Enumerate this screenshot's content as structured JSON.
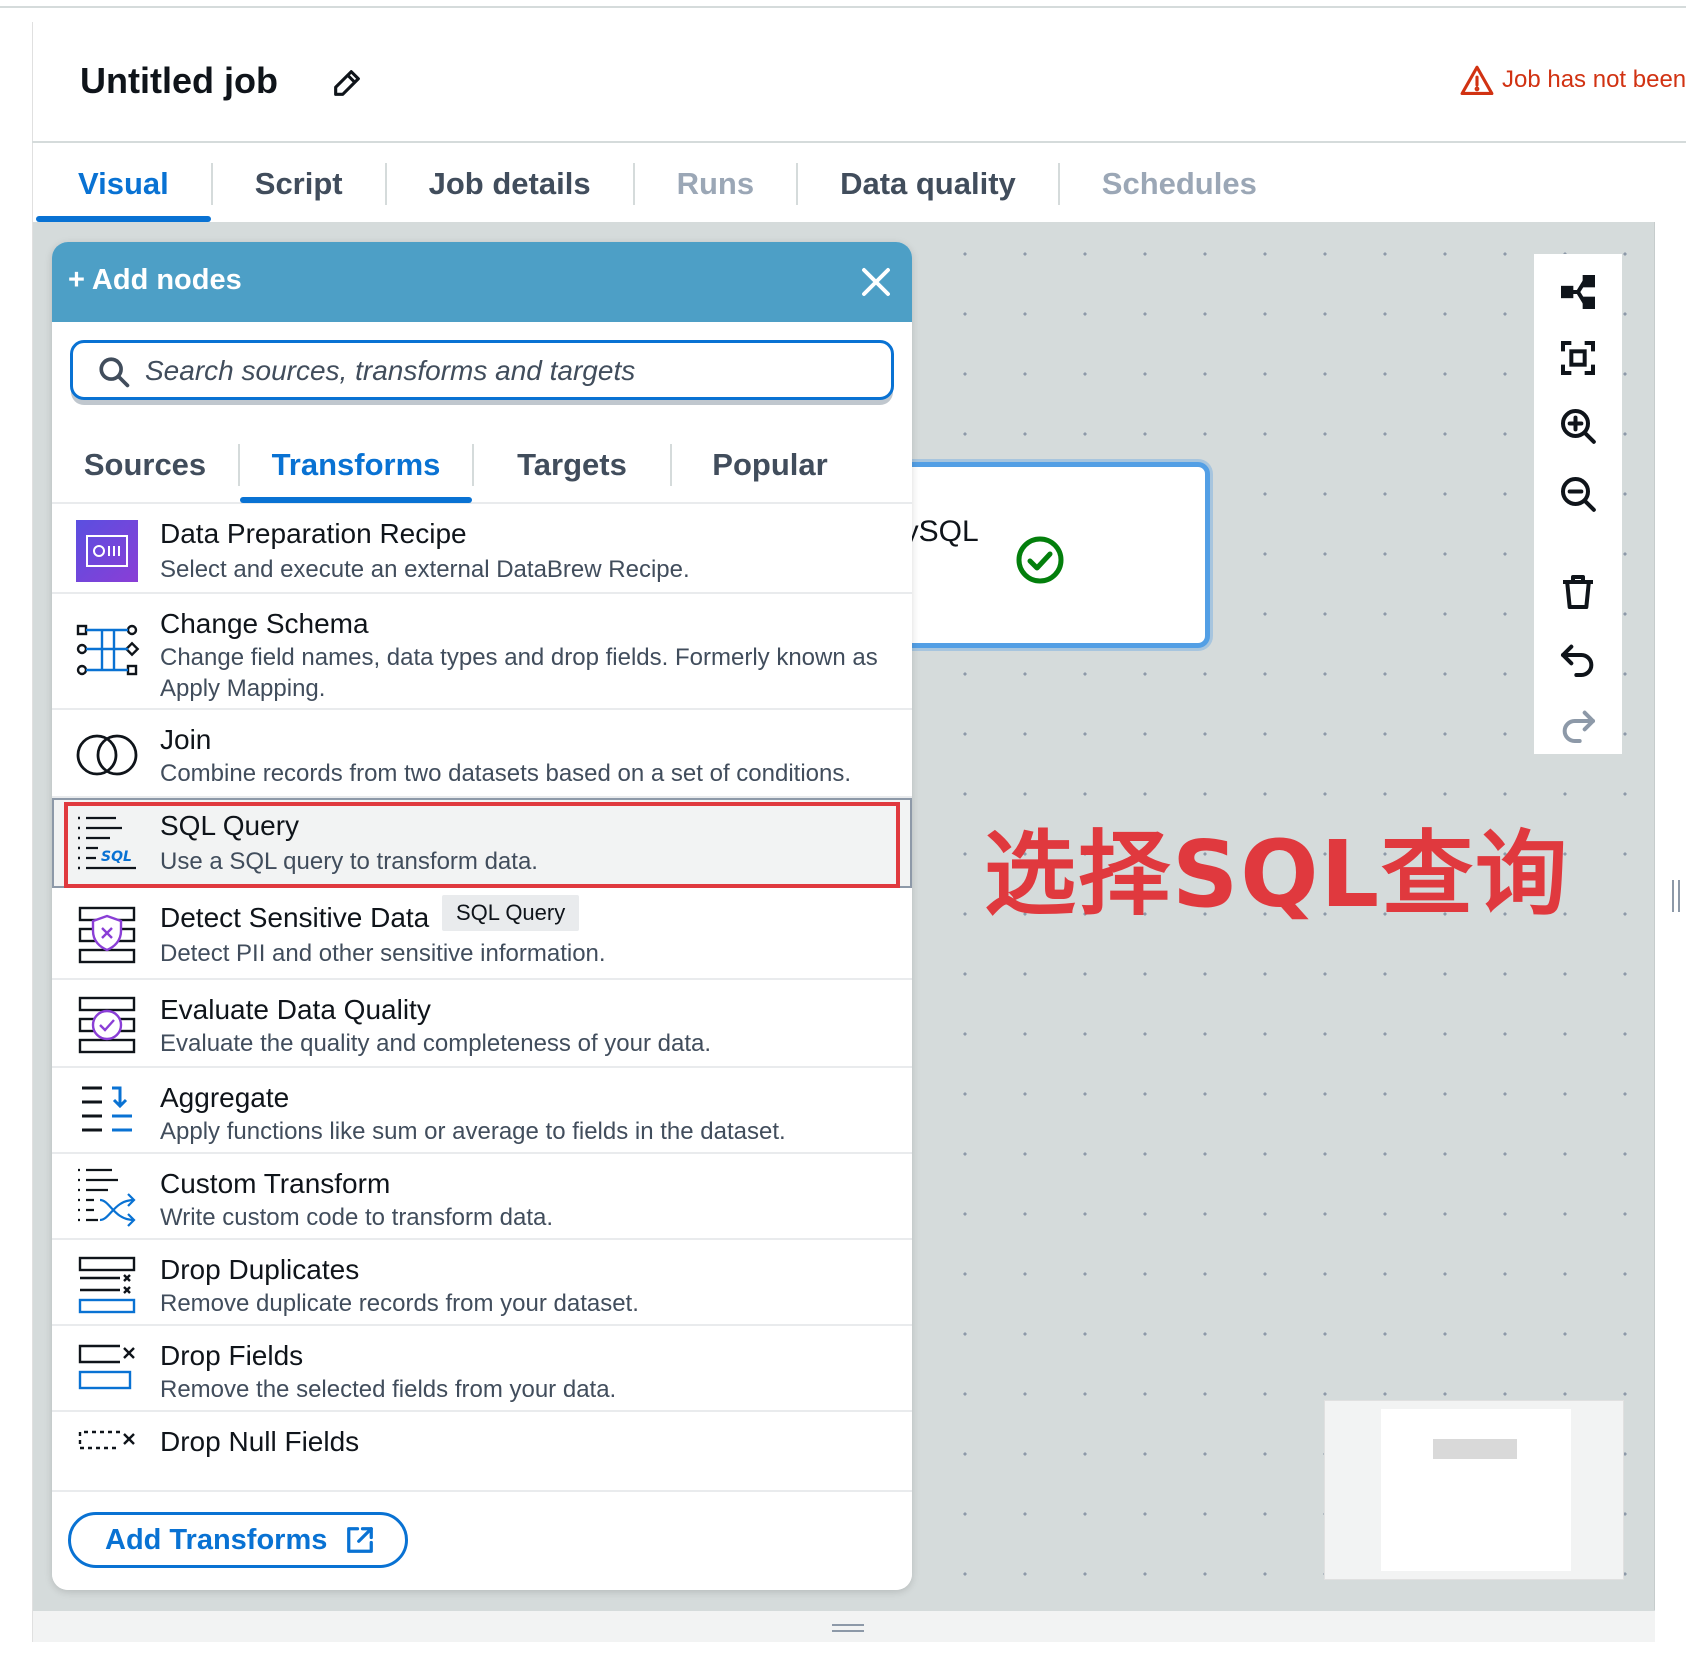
{
  "header": {
    "title": "Untitled job",
    "warning": "Job has not been"
  },
  "tabs": [
    {
      "label": "Visual",
      "state": "active"
    },
    {
      "label": "Script",
      "state": "normal"
    },
    {
      "label": "Job details",
      "state": "normal"
    },
    {
      "label": "Runs",
      "state": "disabled"
    },
    {
      "label": "Data quality",
      "state": "normal"
    },
    {
      "label": "Schedules",
      "state": "disabled"
    }
  ],
  "panel": {
    "title": "+ Add nodes",
    "search_placeholder": "Search sources, transforms and targets",
    "tabs": [
      {
        "label": "Sources",
        "state": "normal"
      },
      {
        "label": "Transforms",
        "state": "active"
      },
      {
        "label": "Targets",
        "state": "normal"
      },
      {
        "label": "Popular",
        "state": "normal"
      }
    ],
    "items": [
      {
        "title": "Data Preparation Recipe",
        "desc": "Select and execute an external DataBrew Recipe.",
        "icon": "databrew-recipe-icon"
      },
      {
        "title": "Change Schema",
        "desc": "Change field names, data types and drop fields. Formerly known as Apply Mapping.",
        "icon": "change-schema-icon"
      },
      {
        "title": "Join",
        "desc": "Combine records from two datasets based on a set of conditions.",
        "icon": "join-icon"
      },
      {
        "title": "SQL Query",
        "desc": "Use a SQL query to transform data.",
        "icon": "sql-query-icon",
        "selected": true
      },
      {
        "title": "Detect Sensitive Data",
        "desc": "Detect PII and other sensitive information.",
        "icon": "detect-sensitive-data-icon"
      },
      {
        "title": "Evaluate Data Quality",
        "desc": "Evaluate the quality and completeness of your data.",
        "icon": "evaluate-data-quality-icon"
      },
      {
        "title": "Aggregate",
        "desc": "Apply functions like sum or average to fields in the dataset.",
        "icon": "aggregate-icon"
      },
      {
        "title": "Custom Transform",
        "desc": "Write custom code to transform data.",
        "icon": "custom-transform-icon"
      },
      {
        "title": "Drop Duplicates",
        "desc": "Remove duplicate records from your dataset.",
        "icon": "drop-duplicates-icon"
      },
      {
        "title": "Drop Fields",
        "desc": "Remove the selected fields from your data.",
        "icon": "drop-fields-icon"
      },
      {
        "title": "Drop Null Fields",
        "desc": "",
        "icon": "drop-null-fields-icon"
      }
    ],
    "tooltip": "SQL Query",
    "footer_button": "Add Transforms"
  },
  "canvas": {
    "node_label": "lySQL",
    "annotation": "选择SQL查询"
  },
  "colors": {
    "accent": "#0972d3",
    "header_blue": "#4d9fc6",
    "annotation_red": "#e0393e",
    "warning_red": "#d13212",
    "success_green": "#037f0c"
  }
}
